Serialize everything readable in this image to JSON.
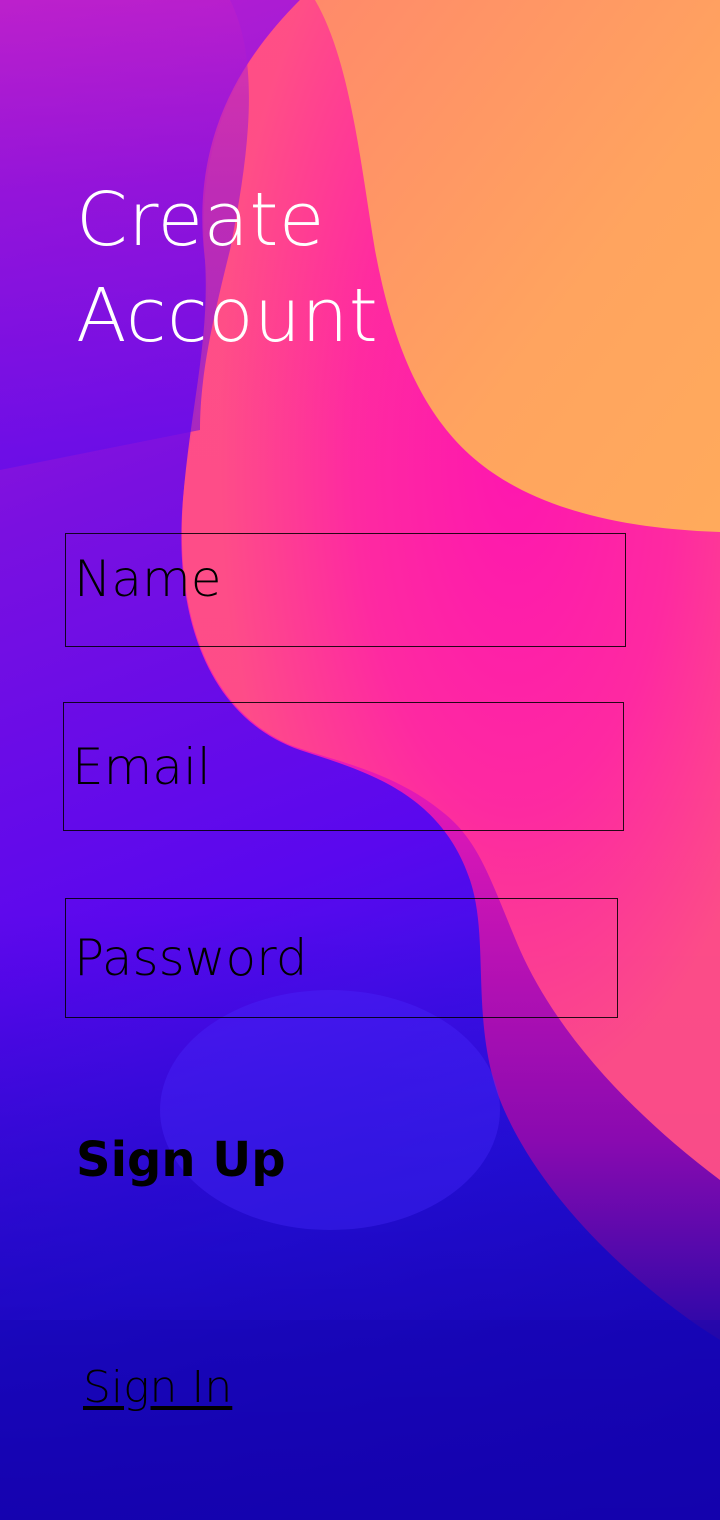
{
  "screen": {
    "title_line1": "Create",
    "title_line2": "Account"
  },
  "form": {
    "name_placeholder": "Name",
    "email_placeholder": "Email",
    "password_placeholder": "Password",
    "name_value": "",
    "email_value": "",
    "password_value": ""
  },
  "actions": {
    "signup_label": "Sign Up",
    "signin_label": "Sign In"
  },
  "colors": {
    "title_text": "#ffffff",
    "form_text": "#000000",
    "orange": "#ffa65f",
    "pink": "#ff1aa8",
    "purple": "#7a10e0",
    "blue": "#3a10f0",
    "deep_blue": "#1a08b0"
  }
}
